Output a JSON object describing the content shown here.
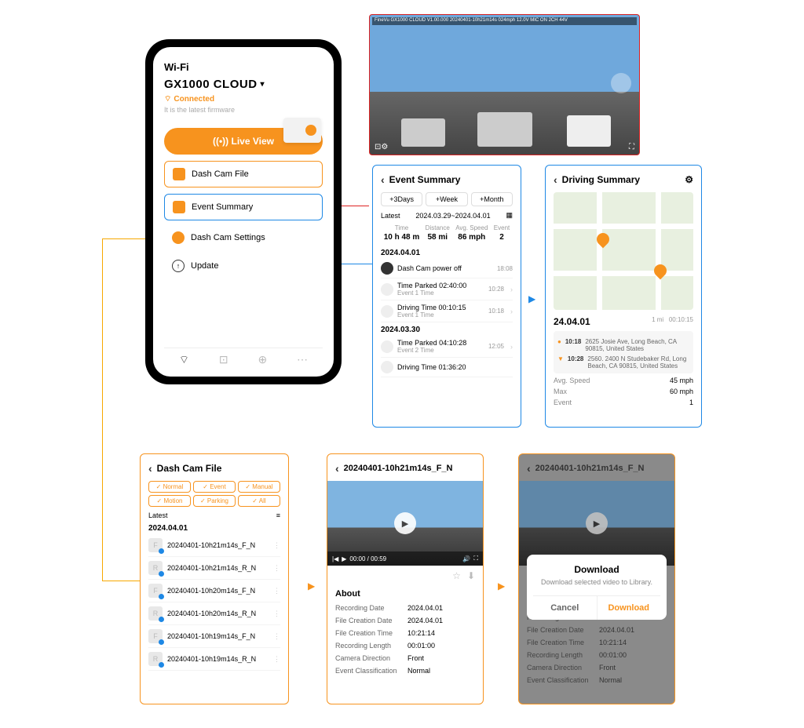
{
  "phone": {
    "wifi_label": "Wi-Fi",
    "device": "GX1000 CLOUD",
    "connected": "Connected",
    "firmware": "It is the latest firmware",
    "live_view": "Live View",
    "menu": {
      "file": "Dash Cam File",
      "event": "Event Summary",
      "settings": "Dash Cam Settings",
      "update": "Update"
    }
  },
  "event_summary": {
    "title": "Event Summary",
    "ranges": [
      "+3Days",
      "+Week",
      "+Month"
    ],
    "latest": "Latest",
    "range_text": "2024.03.29~2024.04.01",
    "stat_labels": [
      "Time",
      "Distance",
      "Avg. Speed",
      "Event"
    ],
    "stat_values": [
      "10 h 48 m",
      "58 mi",
      "86 mph",
      "2"
    ],
    "groups": [
      {
        "date": "2024.04.01",
        "rows": [
          {
            "t": "Dash Cam power off",
            "s": "",
            "r": "18:08"
          },
          {
            "t": "Time Parked 02:40:00",
            "s": "Event 1 Time",
            "r": "10:28"
          },
          {
            "t": "Driving Time 00:10:15",
            "s": "Event 1 Time",
            "r": "10:18"
          }
        ]
      },
      {
        "date": "2024.03.30",
        "rows": [
          {
            "t": "Time Parked 04:10:28",
            "s": "Event 2 Time",
            "r": "12:05"
          },
          {
            "t": "Driving Time 01:36:20",
            "s": "",
            "r": ""
          }
        ]
      }
    ]
  },
  "driving_summary": {
    "title": "Driving Summary",
    "date": "24.04.01",
    "meta_dist": "1 mi",
    "meta_time": "00:10:15",
    "loc": [
      {
        "t": "10:18",
        "a": "2625 Josie Ave, Long Beach, CA 90815, United States"
      },
      {
        "t": "10:28",
        "a": "2560. 2400 N Studebaker Rd, Long Beach, CA 90815, United States"
      }
    ],
    "kv": [
      [
        "Avg. Speed",
        "45 mph"
      ],
      [
        "Max",
        "60 mph"
      ],
      [
        "Event",
        "1"
      ]
    ]
  },
  "dash_file": {
    "title": "Dash Cam File",
    "filters": [
      "Normal",
      "Event",
      "Manual",
      "Motion",
      "Parking",
      "All"
    ],
    "latest": "Latest",
    "date": "2024.04.01",
    "files": [
      {
        "ch": "F",
        "name": "20240401-10h21m14s_F_N"
      },
      {
        "ch": "R",
        "name": "20240401-10h21m14s_R_N"
      },
      {
        "ch": "F",
        "name": "20240401-10h20m14s_F_N"
      },
      {
        "ch": "R",
        "name": "20240401-10h20m14s_R_N"
      },
      {
        "ch": "F",
        "name": "20240401-10h19m14s_F_N"
      },
      {
        "ch": "R",
        "name": "20240401-10h19m14s_R_N"
      }
    ]
  },
  "detail": {
    "title": "20240401-10h21m14s_F_N",
    "player_time": "00:00 / 00:59",
    "about": "About",
    "rows": [
      [
        "Recording Date",
        "2024.04.01"
      ],
      [
        "File Creation Date",
        "2024.04.01"
      ],
      [
        "File Creation Time",
        "10:21:14"
      ],
      [
        "Recording Length",
        "00:01:00"
      ],
      [
        "Camera Direction",
        "Front"
      ],
      [
        "Event Classification",
        "Normal"
      ]
    ]
  },
  "download": {
    "title": "20240401-10h21m14s_F_N",
    "dlg_title": "Download",
    "dlg_msg": "Download selected video to Library.",
    "cancel": "Cancel",
    "ok": "Download"
  }
}
